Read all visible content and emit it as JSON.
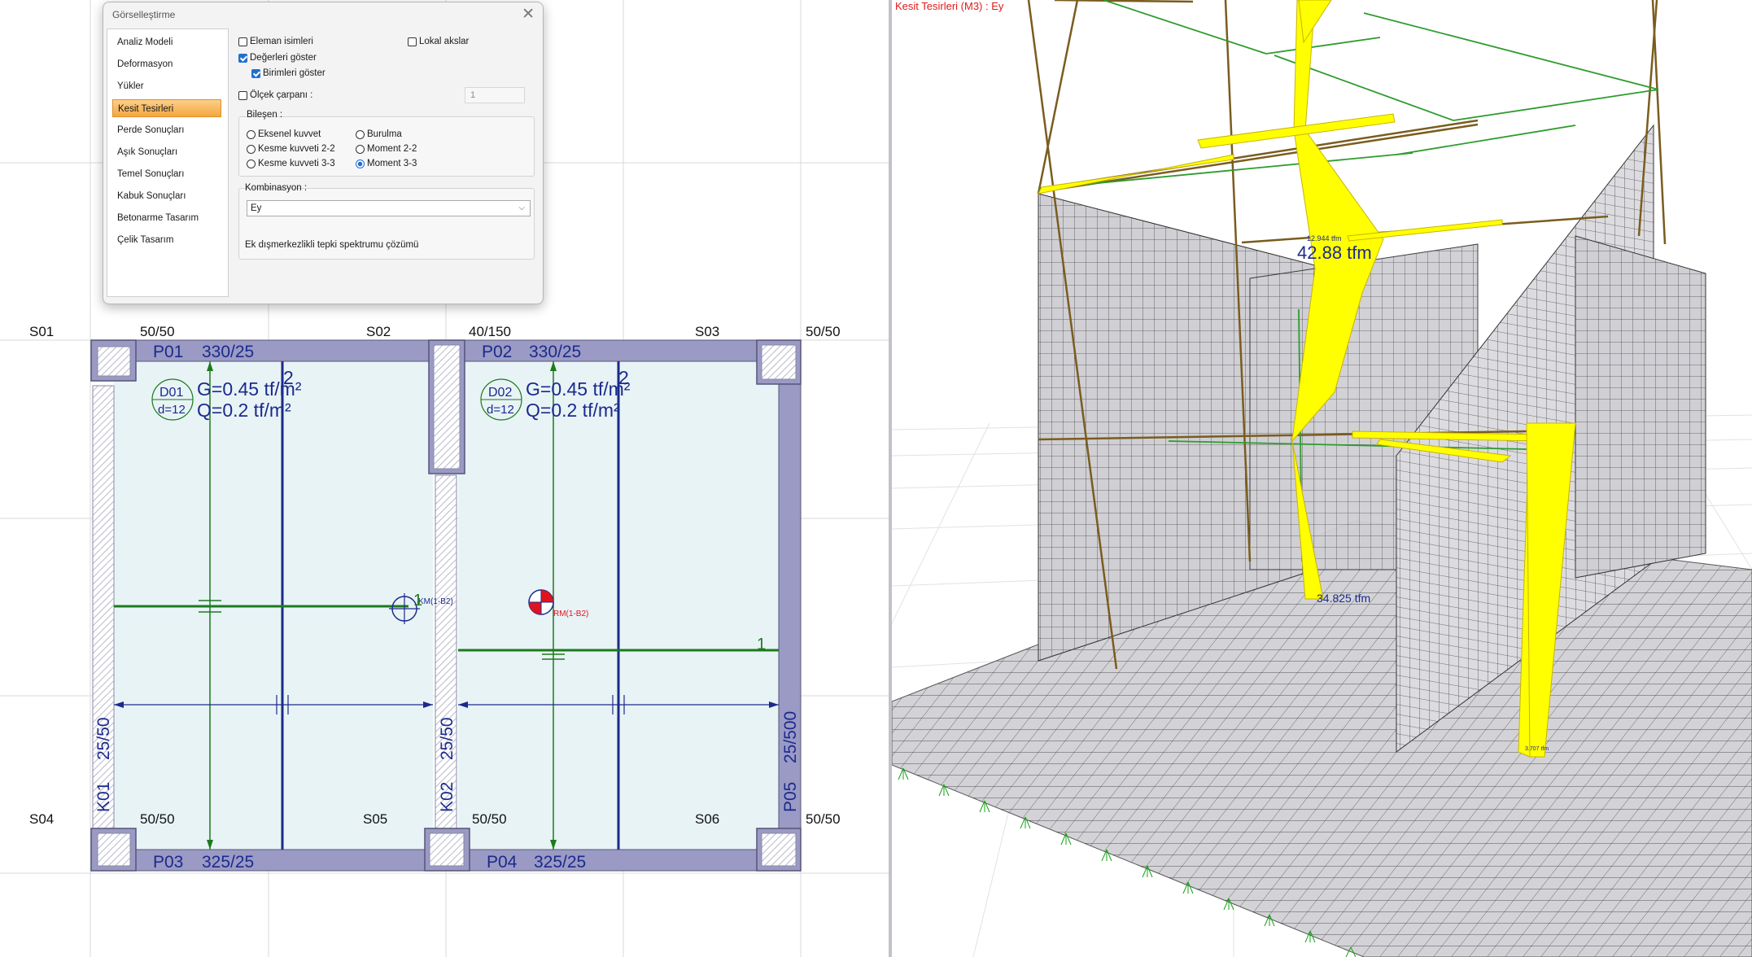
{
  "dialog": {
    "title": "Görselleştirme",
    "nav": [
      {
        "label": "Analiz Modeli",
        "selected": false
      },
      {
        "label": "Deformasyon",
        "selected": false
      },
      {
        "label": "Yükler",
        "selected": false
      },
      {
        "label": "Kesit Tesirleri",
        "selected": true
      },
      {
        "label": "Perde Sonuçları",
        "selected": false
      },
      {
        "label": "Aşık Sonuçları",
        "selected": false
      },
      {
        "label": "Temel Sonuçları",
        "selected": false
      },
      {
        "label": "Kabuk Sonuçları",
        "selected": false
      },
      {
        "label": "Betonarme Tasarım",
        "selected": false
      },
      {
        "label": "Çelik Tasarım",
        "selected": false
      }
    ],
    "options": {
      "element_names": {
        "label": "Eleman isimleri",
        "checked": false
      },
      "local_axes": {
        "label": "Lokal akslar",
        "checked": false
      },
      "show_values": {
        "label": "Değerleri göster",
        "checked": true
      },
      "show_units": {
        "label": "Birimleri göster",
        "checked": true
      },
      "scale_factor": {
        "label": "Ölçek çarpanı :",
        "checked": false,
        "value": "1"
      }
    },
    "component": {
      "label": "Bileşen :",
      "options": [
        {
          "label": "Eksenel kuvvet",
          "selected": false
        },
        {
          "label": "Burulma",
          "selected": false
        },
        {
          "label": "Kesme kuvveti 2-2",
          "selected": false
        },
        {
          "label": "Moment 2-2",
          "selected": false
        },
        {
          "label": "Kesme kuvveti 3-3",
          "selected": false
        },
        {
          "label": "Moment 3-3",
          "selected": true
        }
      ]
    },
    "combination": {
      "label": "Kombinasyon :",
      "value": "Ey",
      "note": "Ek dışmerkezlikli tepki spektrumu çözümü"
    }
  },
  "plan": {
    "axes": [
      {
        "name": "S01"
      },
      {
        "name": "S02"
      },
      {
        "name": "S03"
      },
      {
        "name": "S04"
      },
      {
        "name": "S05"
      },
      {
        "name": "S06"
      }
    ],
    "column_sizes": {
      "top_left": "50/50",
      "top_mid": "40/150",
      "top_right": "50/50",
      "bottom_left": "50/50",
      "bottom_mid": "50/50",
      "bottom_right": "50/50"
    },
    "beams": [
      {
        "name": "P01",
        "size": "330/25"
      },
      {
        "name": "P02",
        "size": "330/25"
      },
      {
        "name": "P03",
        "size": "325/25"
      },
      {
        "name": "P04",
        "size": "325/25"
      },
      {
        "name": "K01",
        "size": "25/50"
      },
      {
        "name": "K02",
        "size": "25/50"
      },
      {
        "name": "P05",
        "size": "25/500"
      }
    ],
    "slabs": [
      {
        "name": "D01",
        "thickness": "d=12",
        "G": "G=0.45 tf/m²",
        "Q": "Q=0.2 tf/m²",
        "dir": "2"
      },
      {
        "name": "D02",
        "thickness": "d=12",
        "G": "G=0.45 tf/m²",
        "Q": "Q=0.2 tf/m²",
        "dir": "2"
      }
    ],
    "mass_center": "KM(1-B2)",
    "rigidity_center": "RM(1-B2)",
    "span_marks": [
      "1",
      "1"
    ],
    "colors": {
      "beam": "#9a9ac4",
      "column": "#9a9ac4",
      "slab": "#e8f3f6",
      "rebar_green": "#1d7a1d",
      "rebar_blue": "#1b2a8c"
    }
  },
  "view3d": {
    "title": "Kesit Tesirleri (M3) : Ey",
    "corner_glyph": "△",
    "labels": {
      "max": "42.88 tfm",
      "max_small": "12.944 tfm",
      "min": "34.825 tfm",
      "small_right": "3.707 tfm"
    },
    "colors": {
      "diagram": "#ffff00",
      "wall": "#d9d9d9",
      "frame": "#7a5c1e",
      "frame_green": "#2e9c2e",
      "support": "#1aa01a"
    }
  }
}
